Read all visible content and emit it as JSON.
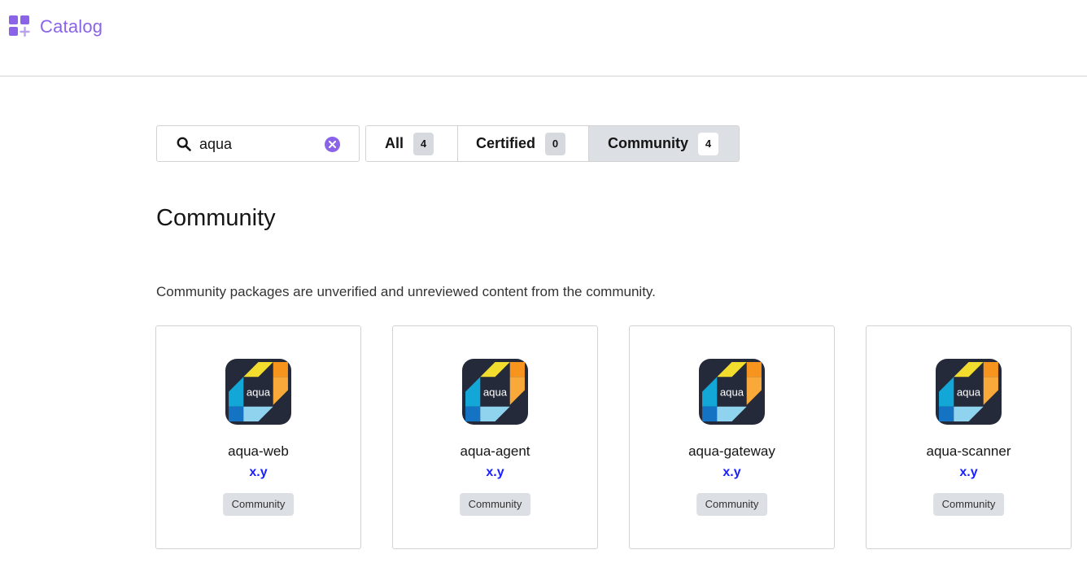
{
  "header": {
    "brand_label": "Catalog"
  },
  "search": {
    "value": "aqua",
    "placeholder": ""
  },
  "tabs": [
    {
      "label": "All",
      "count": "4",
      "active": false
    },
    {
      "label": "Certified",
      "count": "0",
      "active": false
    },
    {
      "label": "Community",
      "count": "4",
      "active": true
    }
  ],
  "section": {
    "title": "Community",
    "description": "Community packages are unverified and unreviewed content from the community."
  },
  "cards": [
    {
      "logo_text": "aqua",
      "name": "aqua-web",
      "version": "x.y",
      "badge": "Community"
    },
    {
      "logo_text": "aqua",
      "name": "aqua-agent",
      "version": "x.y",
      "badge": "Community"
    },
    {
      "logo_text": "aqua",
      "name": "aqua-gateway",
      "version": "x.y",
      "badge": "Community"
    },
    {
      "logo_text": "aqua",
      "name": "aqua-scanner",
      "version": "x.y",
      "badge": "Community"
    }
  ],
  "colors": {
    "accent": "#8a63e8",
    "version": "#1a20ff",
    "active_tab": "#dcdfe3"
  },
  "icons": {
    "brand": "catalog-grid-icon",
    "search": "search-icon",
    "clear": "clear-icon",
    "logo": "aqua-logo-icon"
  }
}
